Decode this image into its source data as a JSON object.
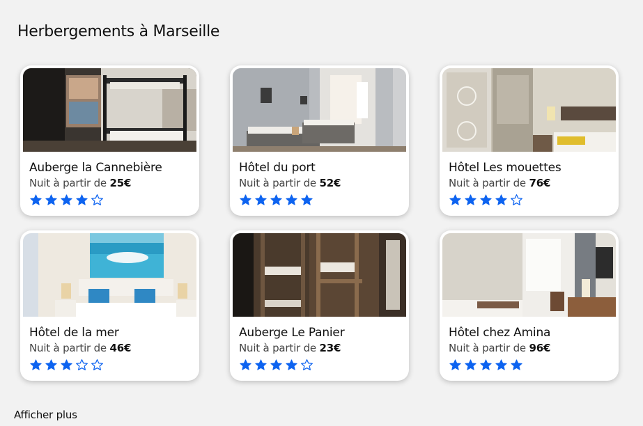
{
  "page": {
    "title": "Herbergements à Marseille",
    "more_label": "Afficher plus"
  },
  "colors": {
    "star": "#0d63f0",
    "background": "#f2f2f2"
  },
  "listings": [
    {
      "name": "Auberge la Cannebière",
      "price_prefix": "Nuit à partir de",
      "price": "25€",
      "rating": 4,
      "max_rating": 5,
      "photo": "bunk-bed-dorm-window"
    },
    {
      "name": "Hôtel du port",
      "price_prefix": "Nuit à partir de",
      "price": "52€",
      "rating": 5,
      "max_rating": 5,
      "photo": "twin-beds-window"
    },
    {
      "name": "Hôtel Les mouettes",
      "price_prefix": "Nuit à partir de",
      "price": "76€",
      "rating": 4,
      "max_rating": 5,
      "photo": "hotel-room-wardrobe"
    },
    {
      "name": "Hôtel de la mer",
      "price_prefix": "Nuit à partir de",
      "price": "46€",
      "rating": 3,
      "max_rating": 5,
      "photo": "bed-sea-painting"
    },
    {
      "name": "Auberge Le Panier",
      "price_prefix": "Nuit à partir de",
      "price": "23€",
      "rating": 4,
      "max_rating": 5,
      "photo": "wooden-bunk-dorm"
    },
    {
      "name": "Hôtel chez Amina",
      "price_prefix": "Nuit à partir de",
      "price": "96€",
      "rating": 5,
      "max_rating": 5,
      "photo": "bright-room-desk"
    }
  ]
}
